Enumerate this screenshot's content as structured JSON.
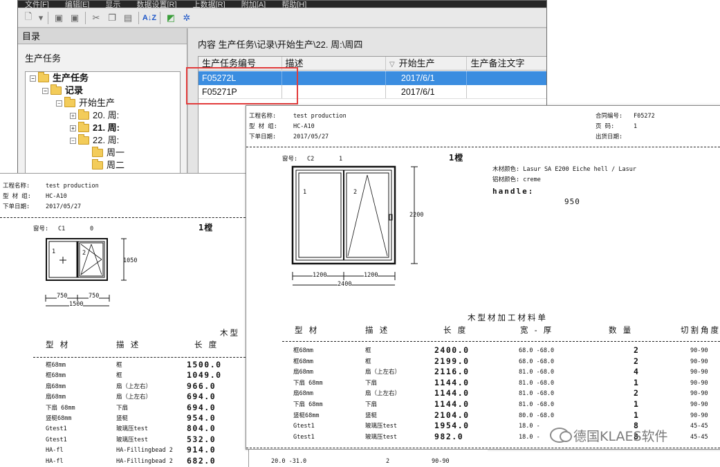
{
  "menubar": {
    "items": [
      "文件[F]",
      "编辑[E]",
      "显示",
      "数据设置[R]",
      "上数据[R]",
      "附加[A]",
      "帮助[H]"
    ]
  },
  "toolbar": {
    "icons": [
      "new-file-icon",
      "dropdown-icon",
      "save-icon",
      "save-all-icon",
      "cut-icon",
      "copy-icon",
      "paste-icon",
      "sort-az-icon",
      "export-icon",
      "settings-icon"
    ]
  },
  "directory": {
    "header": "目录",
    "section": "生产任务",
    "tree": [
      {
        "label": "生产任务",
        "bold": true
      },
      {
        "label": "记录",
        "bold": true
      },
      {
        "label": "开始生产",
        "bold": false
      },
      {
        "label": "20. 周:",
        "bold": false
      },
      {
        "label": "21. 周:",
        "bold": true
      },
      {
        "label": "22. 周:",
        "bold": false
      },
      {
        "label": "周一",
        "bold": false
      },
      {
        "label": "周二",
        "bold": false
      }
    ]
  },
  "content": {
    "path": "内容 生产任务\\记录\\开始生产\\22. 周:\\周四",
    "columns": [
      "生产任务编号",
      "描述",
      "开始生产",
      "生产备注文字"
    ],
    "rows": [
      {
        "id": "F05272L",
        "desc": "",
        "start": "2017/6/1",
        "note": ""
      },
      {
        "id": "F05271P",
        "desc": "",
        "start": "2017/6/1",
        "note": ""
      }
    ]
  },
  "report_left": {
    "project_label": "工程名称:",
    "project": "test production",
    "profile_label": "型 材 组:",
    "profile": "HC-A10",
    "date_label": "下单日期:",
    "date": "2017/05/27",
    "window_no_label": "窗号:",
    "window_no": "C1",
    "window_qty": "0",
    "frame_count": "1樘",
    "height": "1050",
    "widths": [
      "750",
      "750"
    ],
    "total_width": "1500",
    "sash_labels": [
      "1",
      "2"
    ],
    "table_title": "木型",
    "columns": [
      "型 材",
      "描 述",
      "长 度"
    ],
    "rows": [
      [
        "框68mm",
        "框",
        "1500.0"
      ],
      [
        "框68mm",
        "框",
        "1049.0"
      ],
      [
        "扇68mm",
        "扇（上左右）",
        "966.0"
      ],
      [
        "扇68mm",
        "扇（上左右）",
        "694.0"
      ],
      [
        "下扇 68mm",
        "下扇",
        "694.0"
      ],
      [
        "竖梃68mm",
        "竖梃",
        "954.0"
      ],
      [
        "Gtest1",
        "玻璃压test",
        "804.0"
      ],
      [
        "Gtest1",
        "玻璃压test",
        "532.0"
      ],
      [
        "HA-fl",
        "HA-Fillingbead 2",
        "914.0"
      ],
      [
        "HA-fl",
        "HA-Fillingbead 2",
        "682.0"
      ]
    ]
  },
  "report_right": {
    "project_label": "工程名称:",
    "project": "test production",
    "profile_label": "型 材 组:",
    "profile": "HC-A10",
    "date_label": "下单日期:",
    "date": "2017/05/27",
    "contract_label": "合同编号:",
    "contract": "F05272",
    "page_label": "页  码:",
    "page": "1",
    "ship_label": "出货日期:",
    "ship": "",
    "window_no_label": "窗号:",
    "window_no": "C2",
    "window_qty": "1",
    "frame_count": "1樘",
    "wood_color": "木材颜色: Lasur SA E200 Eiche hell / Lasur",
    "alu_color": "铝材颜色: creme",
    "handle_label": "handle:",
    "handle_value": "950",
    "height": "2200",
    "widths": [
      "1200",
      "1200"
    ],
    "total_width": "2400",
    "sash_labels": [
      "1",
      "2"
    ],
    "table_title": "木型材加工材料单",
    "columns": [
      "型  材",
      "描  述",
      "长 度",
      "宽 - 厚",
      "数  量",
      "切割角度"
    ],
    "rows": [
      [
        "框68mm",
        "框",
        "2400.0",
        "68.0 -68.0",
        "2",
        "90-90"
      ],
      [
        "框68mm",
        "框",
        "2199.0",
        "68.0 -68.0",
        "2",
        "90-90"
      ],
      [
        "扇68mm",
        "扇（上左右）",
        "2116.0",
        "81.0 -68.0",
        "4",
        "90-90"
      ],
      [
        "下扇 68mm",
        "下扇",
        "1144.0",
        "81.0 -68.0",
        "1",
        "90-90"
      ],
      [
        "扇68mm",
        "扇（上左右）",
        "1144.0",
        "81.0 -68.0",
        "2",
        "90-90"
      ],
      [
        "下扇 68mm",
        "下扇",
        "1144.0",
        "81.0 -68.0",
        "1",
        "90-90"
      ],
      [
        "竖梃68mm",
        "竖梃",
        "2104.0",
        "80.0 -68.0",
        "1",
        "90-90"
      ],
      [
        "Gtest1",
        "玻璃压test",
        "1954.0",
        "18.0 -",
        "8",
        "45-45"
      ],
      [
        "Gtest1",
        "玻璃压test",
        "982.0",
        "18.0 -",
        "8",
        "45-45"
      ]
    ]
  },
  "footer_strip": {
    "dims": "20.0 -31.0",
    "qty": "2",
    "angle": "90-90"
  },
  "watermark": {
    "text": "德国KLAES软件"
  }
}
